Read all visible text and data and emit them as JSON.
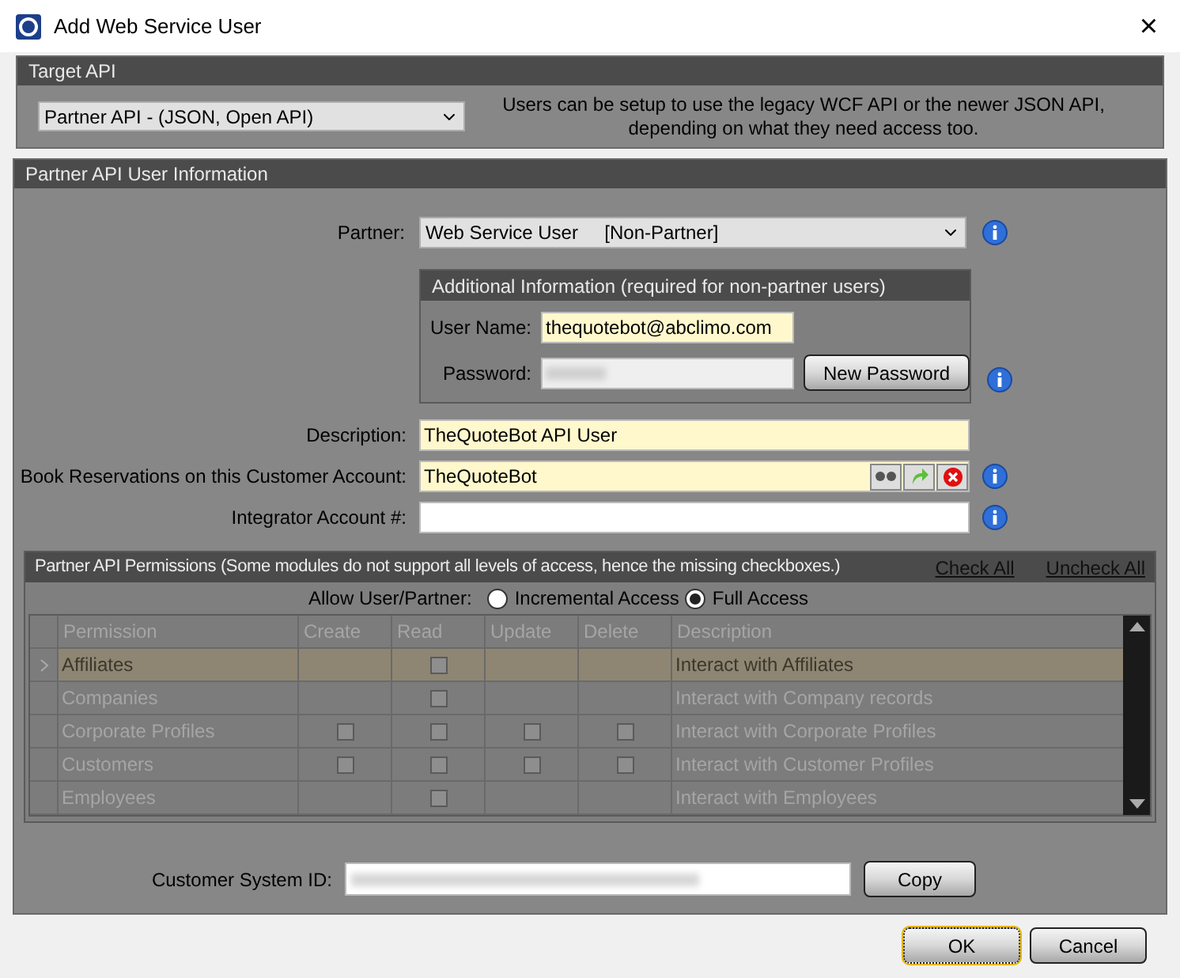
{
  "window": {
    "title": "Add Web Service User",
    "close": "×"
  },
  "target_api": {
    "title": "Target API",
    "select": "Partner API  -  (JSON, Open API)",
    "note": "Users can be setup to use the legacy WCF API or the newer JSON API, depending on what they need access too."
  },
  "user_info": {
    "title": "Partner API User Information",
    "partner": {
      "label": "Partner:",
      "value": "Web Service User     [Non-Partner]"
    },
    "additional": {
      "title": "Additional Information (required for non-partner users)",
      "user_name_label": "User Name:",
      "user_name": "thequotebot@abclimo.com",
      "password_label": "Password:",
      "new_password": "New Password"
    },
    "description": {
      "label": "Description:",
      "value": "TheQuoteBot API User"
    },
    "book": {
      "label": "Book Reservations on this Customer Account:",
      "value": "TheQuoteBot"
    },
    "integrator": {
      "label": "Integrator Account #:"
    }
  },
  "permissions": {
    "title": "Partner API Permissions (Some modules do not support  all levels of access, hence the missing checkboxes.)",
    "check_all": "Check All",
    "uncheck_all": "Uncheck All",
    "allow_label": "Allow User/Partner:",
    "options": [
      {
        "label": "Incremental Access",
        "selected": false
      },
      {
        "label": "Full Access",
        "selected": true
      }
    ],
    "columns": [
      "Permission",
      "Create",
      "Read",
      "Update",
      "Delete",
      "Description"
    ],
    "rows": [
      {
        "permission": "Affiliates",
        "read": false,
        "description": "Interact with Affiliates",
        "selected": true
      },
      {
        "permission": "Companies",
        "read": false,
        "description": "Interact with Company records",
        "selected": false
      },
      {
        "permission": "Corporate Profiles",
        "create": false,
        "read": false,
        "update": false,
        "delete": false,
        "description": "Interact with Corporate Profiles",
        "selected": false
      },
      {
        "permission": "Customers",
        "create": false,
        "read": false,
        "update": false,
        "delete": false,
        "description": "Interact with Customer Profiles",
        "selected": false
      },
      {
        "permission": "Employees",
        "read": false,
        "description": "Interact with Employees",
        "selected": false
      }
    ]
  },
  "system_id": {
    "label": "Customer System ID:",
    "copy": "Copy"
  },
  "buttons": [
    {
      "label": "OK",
      "selected": true
    },
    {
      "label": "Cancel",
      "selected": false
    }
  ]
}
